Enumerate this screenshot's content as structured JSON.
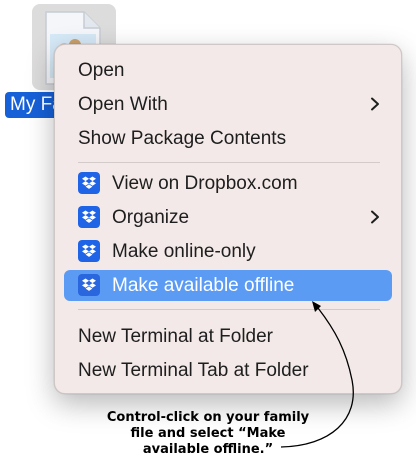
{
  "desktop": {
    "file_label": "My Family"
  },
  "context_menu": {
    "group1": [
      {
        "label": "Open",
        "has_submenu": false
      },
      {
        "label": "Open With",
        "has_submenu": true
      },
      {
        "label": "Show Package Contents",
        "has_submenu": false
      }
    ],
    "group2": [
      {
        "label": "View on Dropbox.com",
        "icon": "dropbox-icon",
        "has_submenu": false
      },
      {
        "label": "Organize",
        "icon": "dropbox-icon",
        "has_submenu": true
      },
      {
        "label": "Make online-only",
        "icon": "dropbox-icon",
        "has_submenu": false
      },
      {
        "label": "Make available offline",
        "icon": "dropbox-icon",
        "has_submenu": false,
        "highlighted": true
      }
    ],
    "group3": [
      {
        "label": "New Terminal at Folder",
        "has_submenu": false
      },
      {
        "label": "New Terminal Tab at Folder",
        "has_submenu": false
      }
    ]
  },
  "annotation": {
    "line1": "Control-click on your family",
    "line2": "file and select “Make",
    "line3": "available offline.”"
  },
  "colors": {
    "menu_background": "#f2e9e8",
    "highlight": "#5b9bf3",
    "dropbox_blue": "#1f64e6",
    "selection_blue": "#1660d8"
  }
}
